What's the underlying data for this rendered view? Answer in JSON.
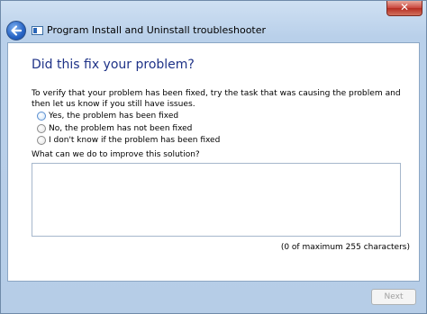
{
  "window": {
    "close_label": "✕",
    "title": "Program Install and Uninstall troubleshooter"
  },
  "main": {
    "heading": "Did this fix your problem?",
    "intro": "To verify that your problem has been fixed, try the task that was causing the problem and then let us know if you still have issues.",
    "options": [
      {
        "label": "Yes, the problem has been fixed"
      },
      {
        "label": "No, the problem has not been fixed"
      },
      {
        "label": "I don't know if the problem has been fixed"
      }
    ],
    "improve_label": "What can we do to improve this solution?",
    "feedback_value": "",
    "char_count": "(0 of maximum 255 characters)"
  },
  "footer": {
    "next_label": "Next"
  }
}
